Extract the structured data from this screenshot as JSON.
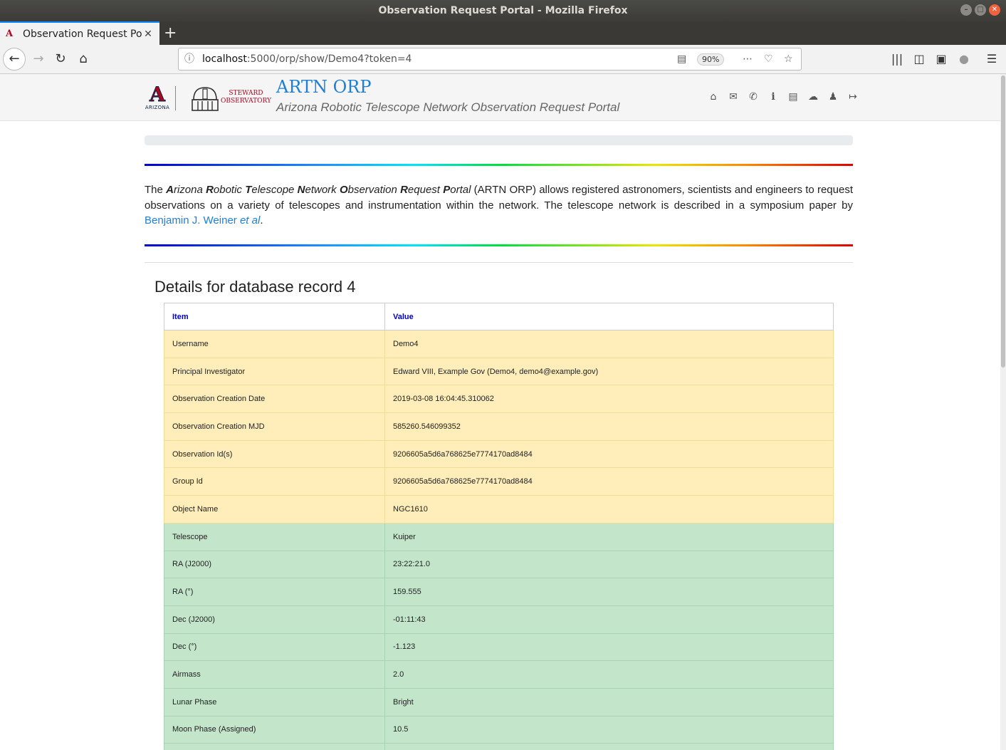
{
  "window": {
    "title": "Observation Request Portal - Mozilla Firefox"
  },
  "tab": {
    "title": "Observation Request Po",
    "close": "✕",
    "new": "+"
  },
  "urlbar": {
    "host": "localhost",
    "path": ":5000/orp/show/Demo4?token=4",
    "zoom": "90%"
  },
  "header": {
    "university": "ARIZONA",
    "observatory_line1": "STEWARD",
    "observatory_line2": "OBSERVATORY",
    "brand": "ARTN ORP",
    "subtitle": "Arizona Robotic Telescope Network Observation Request Portal",
    "icons": [
      "home-icon",
      "envelope-icon",
      "phone-icon",
      "info-icon",
      "book-icon",
      "comments-icon",
      "user-icon",
      "sign-out-icon"
    ]
  },
  "intro": {
    "the": "The",
    "A": "A",
    "rizona": "rizona",
    "R": "R",
    "obotic": "obotic",
    "T": "T",
    "elescope": "elescope",
    "N": "N",
    "etwork": "etwork",
    "O": "O",
    "bservation": "bservation",
    "R2": "R",
    "equest": "equest",
    "P": "P",
    "ortal": "ortal",
    "body": " (ARTN ORP) allows registered astronomers, scientists and engineers to request observations on a variety of telescopes and instrumentation within the network. The telescope network is described in a symposium paper by ",
    "link_author": "Benjamin J. Weiner ",
    "link_etal": "et al",
    "end": "."
  },
  "details": {
    "heading": "Details for database record 4",
    "col_item": "Item",
    "col_value": "Value",
    "rows": [
      {
        "item": "Username",
        "value": "Demo4",
        "status": "warn"
      },
      {
        "item": "Principal Investigator",
        "value": "Edward VIII, Example Gov (Demo4, demo4@example.gov)",
        "status": "warn"
      },
      {
        "item": "Observation Creation Date",
        "value": "2019-03-08 16:04:45.310062",
        "status": "warn"
      },
      {
        "item": "Observation Creation MJD",
        "value": "585260.546099352",
        "status": "warn"
      },
      {
        "item": "Observation Id(s)",
        "value": "9206605a5d6a768625e7774170ad8484",
        "status": "warn"
      },
      {
        "item": "Group Id",
        "value": "9206605a5d6a768625e7774170ad8484",
        "status": "warn"
      },
      {
        "item": "Object Name",
        "value": "NGC1610",
        "status": "warn"
      },
      {
        "item": "Telescope",
        "value": "Kuiper",
        "status": "ok"
      },
      {
        "item": "RA (J2000)",
        "value": "23:22:21.0",
        "status": "ok"
      },
      {
        "item": "RA (°)",
        "value": "159.555",
        "status": "ok"
      },
      {
        "item": "Dec (J2000)",
        "value": "-01:11:43",
        "status": "ok"
      },
      {
        "item": "Dec (°)",
        "value": "-1.123",
        "status": "ok"
      },
      {
        "item": "Airmass",
        "value": "2.0",
        "status": "ok"
      },
      {
        "item": "Lunar Phase",
        "value": "Bright",
        "status": "ok"
      },
      {
        "item": "Moon Phase (Assigned)",
        "value": "10.5",
        "status": "ok"
      },
      {
        "item": "",
        "value": "",
        "status": "ok"
      }
    ]
  },
  "colors": {
    "brand": "#1e7fd8",
    "warn_row": "#ffeeba",
    "ok_row": "#c3e6cb",
    "ua_red": "#ab0520"
  }
}
